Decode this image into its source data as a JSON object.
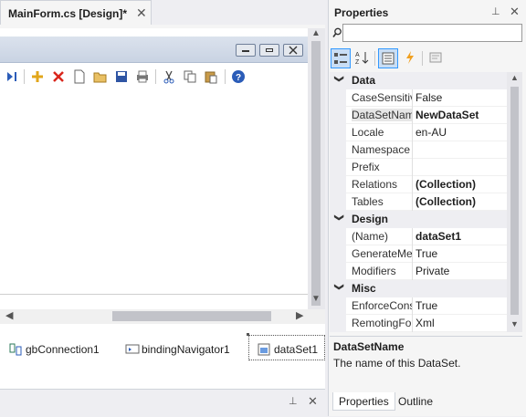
{
  "document": {
    "tab_title": "MainForm.cs [Design]*",
    "close_glyph": "✕"
  },
  "form": {
    "caption_buttons": [
      "minimize",
      "restore",
      "close"
    ]
  },
  "navigator_toolbar": {
    "icons": [
      "move-last-icon",
      "add-new-icon",
      "delete-icon",
      "new-file-icon",
      "open-folder-icon",
      "save-icon",
      "print-icon",
      "cut-icon",
      "copy-icon",
      "paste-icon",
      "help-icon"
    ]
  },
  "component_tray": {
    "items": [
      {
        "label": "gbConnection1",
        "icon": "connection-icon"
      },
      {
        "label": "bindingNavigator1",
        "icon": "binding-navigator-icon"
      },
      {
        "label": "dataSet1",
        "icon": "dataset-icon"
      }
    ]
  },
  "bottom_panel": {
    "pin_glyph": "⊥",
    "close_glyph": "✕"
  },
  "properties": {
    "title": "Properties",
    "pin_glyph": "⊥",
    "close_glyph": "✕",
    "object_selector_value": "",
    "toolbar": [
      "categorized-icon",
      "alphabetical-icon",
      "properties-icon",
      "events-icon",
      "property-pages-icon"
    ],
    "categories": [
      {
        "name": "Data",
        "rows": [
          {
            "name": "CaseSensitive",
            "value": "False",
            "bold": false
          },
          {
            "name": "DataSetName",
            "value": "NewDataSet",
            "bold": true,
            "selected": true
          },
          {
            "name": "Locale",
            "value": "en-AU",
            "bold": false
          },
          {
            "name": "Namespace",
            "value": "",
            "bold": false
          },
          {
            "name": "Prefix",
            "value": "",
            "bold": false
          },
          {
            "name": "Relations",
            "value": "(Collection)",
            "bold": true
          },
          {
            "name": "Tables",
            "value": "(Collection)",
            "bold": true
          }
        ]
      },
      {
        "name": "Design",
        "rows": [
          {
            "name": "(Name)",
            "value": "dataSet1",
            "bold": true
          },
          {
            "name": "GenerateMember",
            "value": "True",
            "bold": false
          },
          {
            "name": "Modifiers",
            "value": "Private",
            "bold": false
          }
        ]
      },
      {
        "name": "Misc",
        "rows": [
          {
            "name": "EnforceConstraints",
            "value": "True",
            "bold": false
          },
          {
            "name": "RemotingFormat",
            "value": "Xml",
            "bold": false
          }
        ]
      }
    ],
    "description": {
      "title": "DataSetName",
      "text": "The name of this DataSet."
    },
    "tabs": [
      {
        "label": "Properties",
        "active": true
      },
      {
        "label": "Outline",
        "active": false
      }
    ]
  }
}
